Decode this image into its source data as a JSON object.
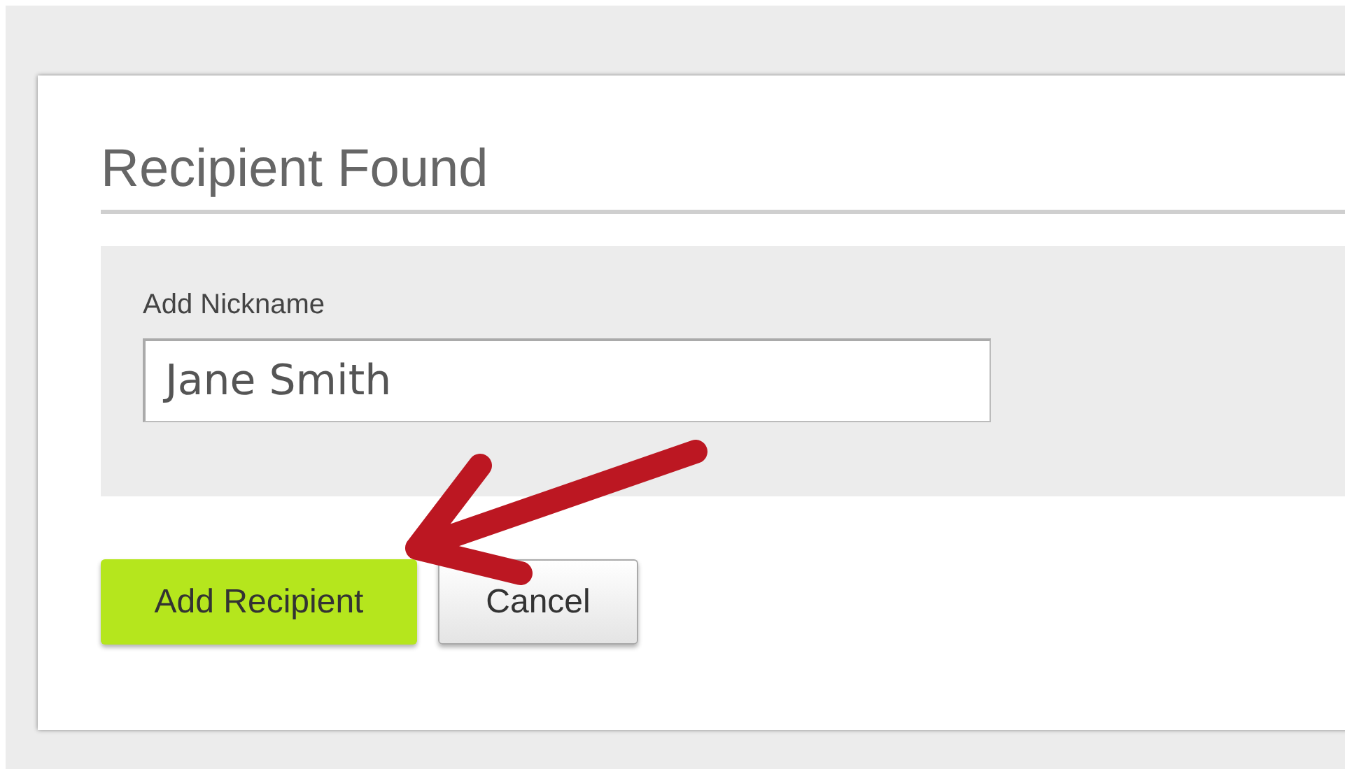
{
  "title": "Recipient Found",
  "nickname_field": {
    "label": "Add Nickname",
    "value": "Jane Smith"
  },
  "buttons": [
    {
      "label": "Add Recipient",
      "kind": "primary"
    },
    {
      "label": "Cancel",
      "kind": "secondary"
    }
  ]
}
